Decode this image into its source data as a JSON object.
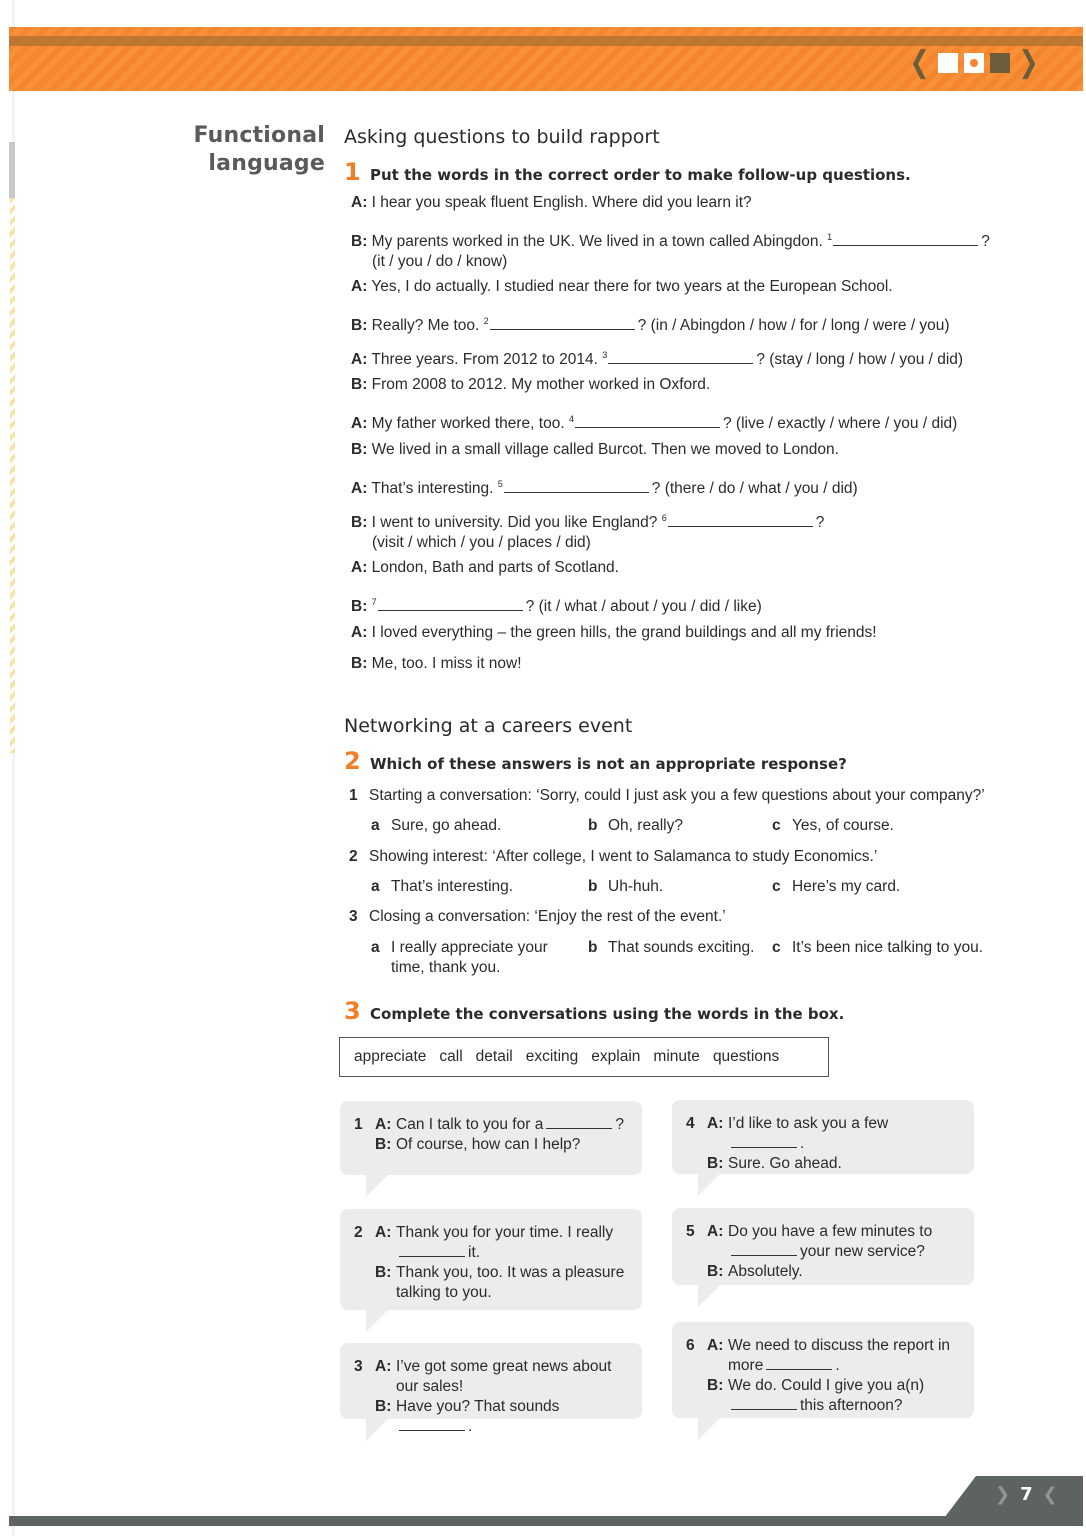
{
  "header": {
    "nav": {
      "prev_icon": "chevron-left-icon",
      "next_icon": "chevron-right-icon",
      "page_indicators": [
        "filled-square",
        "dot-square",
        "dark-square"
      ]
    },
    "accent_color": "#f5862e"
  },
  "section_label": {
    "line1": "Functional",
    "line2": "language"
  },
  "section1": {
    "title": "Asking questions to build rapport",
    "exercise": {
      "number": "1",
      "instruction": "Put the words in the correct order to make follow-up questions.",
      "lines": [
        {
          "speaker": "A:",
          "text": "I hear you speak fluent English. Where did you learn it?"
        },
        {
          "speaker": "B:",
          "text": "My parents worked in the UK. We lived in a town called Abingdon.",
          "gap": "1",
          "after": "?",
          "hint": "(it / you / do / know)"
        },
        {
          "speaker": "A:",
          "text": "Yes, I do actually. I studied near there for two years at the European School."
        },
        {
          "speaker": "B:",
          "text": "Really? Me too.",
          "gap": "2",
          "after": "? (in / Abingdon / how / for / long / were / you)"
        },
        {
          "speaker": "A:",
          "text": "Three years. From 2012 to 2014.",
          "gap": "3",
          "after": "? (stay / long / how / you / did)"
        },
        {
          "speaker": "B:",
          "text": "From 2008 to 2012. My mother worked in Oxford."
        },
        {
          "speaker": "A:",
          "text": "My father worked there, too.",
          "gap": "4",
          "after": "? (live / exactly / where / you / did)"
        },
        {
          "speaker": "B:",
          "text": "We lived in a small village called Burcot. Then we moved to London."
        },
        {
          "speaker": "A:",
          "text": "That’s interesting.",
          "gap": "5",
          "after": "? (there / do / what / you / did)"
        },
        {
          "speaker": "B:",
          "text": "I went to university. Did you like England?",
          "gap": "6",
          "after": "?",
          "hint": "(visit / which / you / places / did)"
        },
        {
          "speaker": "A:",
          "text": "London, Bath and parts of Scotland."
        },
        {
          "speaker": "B:",
          "text": "",
          "gap": "7",
          "after": "? (it / what / about / you / did / like)"
        },
        {
          "speaker": "A:",
          "text": "I loved everything – the green hills, the grand buildings and all my friends!"
        },
        {
          "speaker": "B:",
          "text": "Me, too. I miss it now!"
        }
      ]
    }
  },
  "section2": {
    "title": "Networking at a careers event",
    "exercise": {
      "number": "2",
      "instruction": "Which of these answers is not an appropriate response?",
      "questions": [
        {
          "num": "1",
          "text": "Starting a conversation: ‘Sorry, could I just ask you a few questions about your company?’",
          "options": [
            {
              "letter": "a",
              "text": "Sure, go ahead."
            },
            {
              "letter": "b",
              "text": "Oh, really?"
            },
            {
              "letter": "c",
              "text": "Yes, of course."
            }
          ]
        },
        {
          "num": "2",
          "text": "Showing interest: ‘After college, I went to Salamanca to study Economics.’",
          "options": [
            {
              "letter": "a",
              "text": "That’s interesting."
            },
            {
              "letter": "b",
              "text": "Uh-huh."
            },
            {
              "letter": "c",
              "text": "Here’s my card."
            }
          ]
        },
        {
          "num": "3",
          "text": "Closing a conversation: ‘Enjoy the rest of the event.’",
          "options": [
            {
              "letter": "a",
              "text": "I really appreciate your time, thank you."
            },
            {
              "letter": "b",
              "text": "That sounds exciting."
            },
            {
              "letter": "c",
              "text": "It’s been nice talking to you."
            }
          ]
        }
      ]
    }
  },
  "exercise3": {
    "number": "3",
    "instruction": "Complete the conversations using the words in the box.",
    "word_box": [
      "appreciate",
      "call",
      "detail",
      "exciting",
      "explain",
      "minute",
      "questions"
    ],
    "conversations": [
      {
        "num": "1",
        "a": [
          "Can I talk to you for a",
          "?"
        ],
        "b": [
          "Of course, how can I help?"
        ]
      },
      {
        "num": "2",
        "a": [
          "Thank you for your time. I really",
          "it."
        ],
        "b": [
          "Thank you, too. It was a pleasure talking to you."
        ]
      },
      {
        "num": "3",
        "a": [
          "I’ve got some great news about our sales!"
        ],
        "b": [
          "Have you? That sounds",
          "."
        ]
      },
      {
        "num": "4",
        "a": [
          "I’d like to ask you a few",
          "."
        ],
        "b": [
          "Sure. Go ahead."
        ]
      },
      {
        "num": "5",
        "a": [
          "Do you have a few minutes to",
          "your new service?"
        ],
        "b": [
          "Absolutely."
        ]
      },
      {
        "num": "6",
        "a": [
          "We need to discuss the report in more",
          "."
        ],
        "b": [
          "We do. Could I give you a(n)",
          "this afternoon?"
        ]
      }
    ]
  },
  "footer": {
    "page_number": "7",
    "prev_icon": "chevron-right-icon",
    "next_icon": "chevron-left-icon"
  }
}
